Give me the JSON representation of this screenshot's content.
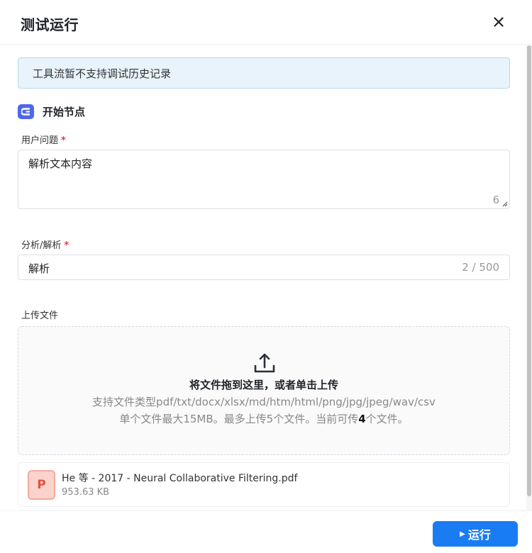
{
  "dialog": {
    "title": "测试运行",
    "close_icon": "close-icon"
  },
  "notice": {
    "text": "工具流暂不支持调试历史记录"
  },
  "start_node": {
    "icon": "start-node-icon",
    "title": "开始节点"
  },
  "fields": {
    "user_question": {
      "label": "用户问题",
      "required": "*",
      "value": "解析文本内容",
      "count": "6"
    },
    "analysis": {
      "label": "分析/解析",
      "required": "*",
      "value": "解析",
      "count": "2 / 500"
    },
    "upload": {
      "label": "上传文件",
      "icon": "upload-icon",
      "main_text": "将文件拖到这里，或者单击上传",
      "types_text": "支持文件类型pdf/txt/docx/xlsx/md/htm/html/png/jpg/jpeg/wav/csv",
      "limit_prefix": "单个文件最大15MB。最多上传5个文件。当前可传",
      "limit_count": "4",
      "limit_suffix": "个文件。"
    }
  },
  "file": {
    "icon_letter": "P",
    "name": "He 等 - 2017 - Neural Collaborative Filtering.pdf",
    "size": "953.63 KB"
  },
  "footer": {
    "run_label": "运行",
    "play_icon": "play-icon"
  },
  "colors": {
    "accent": "#1a7cf3",
    "node_icon": "#4f67ea",
    "required": "#e33a3a",
    "notice_bg": "#e8f3fc",
    "pdf_icon": "#e15241"
  }
}
